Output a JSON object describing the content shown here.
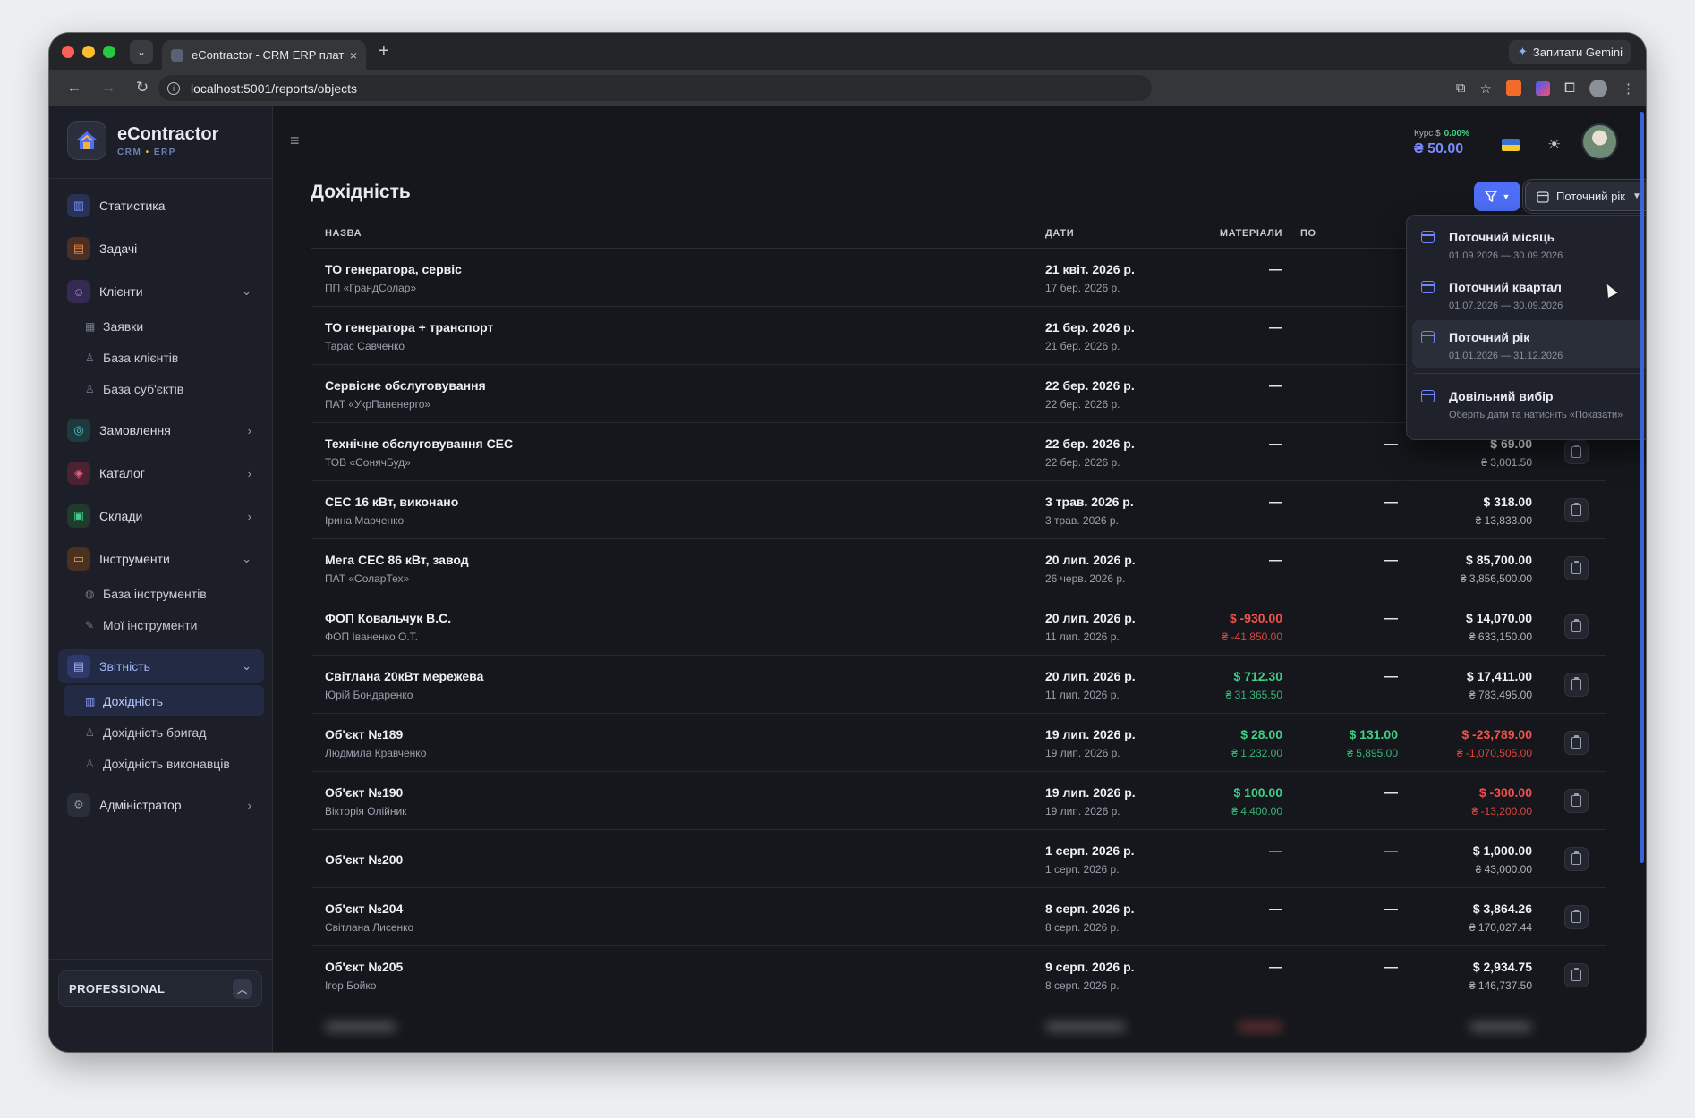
{
  "browser": {
    "tab_title": "eContractor - CRM ERP плат",
    "tab_close": "×",
    "new_tab": "+",
    "url": "localhost:5001/reports/objects",
    "gemini_label": "Запитати Gemini"
  },
  "brand": {
    "name": "eContractor",
    "sub_a": "CRM",
    "sub_sep": "•",
    "sub_b": "ERP"
  },
  "sidebar": {
    "statistics": "Статистика",
    "tasks": "Задачі",
    "clients": "Клієнти",
    "clients_sub": [
      "Заявки",
      "База клієнтів",
      "База суб'єктів"
    ],
    "orders": "Замовлення",
    "catalog": "Каталог",
    "warehouses": "Склади",
    "tools": "Інструменти",
    "tools_sub": [
      "База інструментів",
      "Мої інструменти"
    ],
    "reports": "Звітність",
    "reports_sub": [
      "Дохідність",
      "Дохідність бригад",
      "Дохідність виконавців"
    ],
    "admin": "Адміністратор",
    "plan": "PROFESSIONAL"
  },
  "header": {
    "rate_label": "Курс $",
    "rate_change": "0.00%",
    "rate_value": "₴ 50.00"
  },
  "page": {
    "title": "Дохідність",
    "period_button": "Поточний рік"
  },
  "table": {
    "columns": {
      "name": "НАЗВА",
      "dates": "ДАТИ",
      "materials": "МАТЕРІАЛИ",
      "cut": "ПО"
    },
    "rows": [
      {
        "name": "ТО генератора, сервіс",
        "client": "ПП «ГрандСолар»",
        "date": "21 квіт. 2026 р.",
        "date2": "17 бер. 2026 р.",
        "mat": "—",
        "mat2": "",
        "mat_type": "dash",
        "pos": "",
        "pos2": "",
        "pos_type": "none",
        "total": "",
        "total2": "",
        "total_type": "none"
      },
      {
        "name": "ТО генератора + транспорт",
        "client": "Тарас Савченко",
        "date": "21 бер. 2026 р.",
        "date2": "21 бер. 2026 р.",
        "mat": "—",
        "mat2": "",
        "mat_type": "dash",
        "pos": "",
        "pos2": "",
        "pos_type": "none",
        "total": "",
        "total2": "",
        "total_type": "none"
      },
      {
        "name": "Сервісне обслуговування",
        "client": "ПАТ «УкрПаненерго»",
        "date": "22 бер. 2026 р.",
        "date2": "22 бер. 2026 р.",
        "mat": "—",
        "mat2": "",
        "mat_type": "dash",
        "pos": "",
        "pos2": "",
        "pos_type": "none",
        "total": "",
        "total2": "",
        "total_type": "none"
      },
      {
        "name": "Технічне обслуговування СЕС",
        "client": "ТОВ «СонячБуд»",
        "date": "22 бер. 2026 р.",
        "date2": "22 бер. 2026 р.",
        "mat": "—",
        "mat2": "",
        "mat_type": "dash",
        "pos": "—",
        "pos2": "",
        "pos_type": "dash",
        "total": "$ 69.00",
        "total2": "₴ 3,001.50",
        "total_type": "wht"
      },
      {
        "name": "СЕС 16 кВт, виконано",
        "client": "Ірина Марченко",
        "date": "3 трав. 2026 р.",
        "date2": "3 трав. 2026 р.",
        "mat": "—",
        "mat2": "",
        "mat_type": "dash",
        "pos": "—",
        "pos2": "",
        "pos_type": "dash",
        "total": "$ 318.00",
        "total2": "₴ 13,833.00",
        "total_type": "wht"
      },
      {
        "name": "Мега СЕС 86 кВт, завод",
        "client": "ПАТ «СоларТех»",
        "date": "20 лип. 2026 р.",
        "date2": "26 черв. 2026 р.",
        "mat": "—",
        "mat2": "",
        "mat_type": "dash",
        "pos": "—",
        "pos2": "",
        "pos_type": "dash",
        "total": "$ 85,700.00",
        "total2": "₴ 3,856,500.00",
        "total_type": "wht"
      },
      {
        "name": "ФОП Ковальчук В.С.",
        "client": "ФОП Іваненко О.Т.",
        "date": "20 лип. 2026 р.",
        "date2": "11 лип. 2026 р.",
        "mat": "$ -930.00",
        "mat2": "₴ -41,850.00",
        "mat_type": "neg",
        "pos": "—",
        "pos2": "",
        "pos_type": "dash",
        "total": "$ 14,070.00",
        "total2": "₴ 633,150.00",
        "total_type": "wht"
      },
      {
        "name": "Світлана 20кВт мережева",
        "client": "Юрій Бондаренко",
        "date": "20 лип. 2026 р.",
        "date2": "11 лип. 2026 р.",
        "mat": "$ 712.30",
        "mat2": "₴ 31,365.50",
        "mat_type": "pos",
        "pos": "—",
        "pos2": "",
        "pos_type": "dash",
        "total": "$ 17,411.00",
        "total2": "₴ 783,495.00",
        "total_type": "wht"
      },
      {
        "name": "Об'єкт №189",
        "client": "Людмила Кравченко",
        "date": "19 лип. 2026 р.",
        "date2": "19 лип. 2026 р.",
        "mat": "$ 28.00",
        "mat2": "₴ 1,232.00",
        "mat_type": "pos",
        "pos": "$ 131.00",
        "pos2": "₴ 5,895.00",
        "pos_type": "pos",
        "total": "$ -23,789.00",
        "total2": "₴ -1,070,505.00",
        "total_type": "neg"
      },
      {
        "name": "Об'єкт №190",
        "client": "Вікторія Олійник",
        "date": "19 лип. 2026 р.",
        "date2": "19 лип. 2026 р.",
        "mat": "$ 100.00",
        "mat2": "₴ 4,400.00",
        "mat_type": "pos",
        "pos": "—",
        "pos2": "",
        "pos_type": "dash",
        "total": "$ -300.00",
        "total2": "₴ -13,200.00",
        "total_type": "neg"
      },
      {
        "name": "Об'єкт №200",
        "client": "",
        "date": "1 серп. 2026 р.",
        "date2": "1 серп. 2026 р.",
        "mat": "—",
        "mat2": "",
        "mat_type": "dash",
        "pos": "—",
        "pos2": "",
        "pos_type": "dash",
        "total": "$ 1,000.00",
        "total2": "₴ 43,000.00",
        "total_type": "wht"
      },
      {
        "name": "Об'єкт №204",
        "client": "Світлана Лисенко",
        "date": "8 серп. 2026 р.",
        "date2": "8 серп. 2026 р.",
        "mat": "—",
        "mat2": "",
        "mat_type": "dash",
        "pos": "—",
        "pos2": "",
        "pos_type": "dash",
        "total": "$ 3,864.26",
        "total2": "₴ 170,027.44",
        "total_type": "wht"
      },
      {
        "name": "Об'єкт №205",
        "client": "Ігор Бойко",
        "date": "9 серп. 2026 р.",
        "date2": "8 серп. 2026 р.",
        "mat": "—",
        "mat2": "",
        "mat_type": "dash",
        "pos": "—",
        "pos2": "",
        "pos_type": "dash",
        "total": "$ 2,934.75",
        "total2": "₴ 146,737.50",
        "total_type": "wht"
      }
    ]
  },
  "dropdown": {
    "options": [
      {
        "label": "Поточний місяць",
        "desc": "01.09.2026 — 30.09.2026",
        "selected": false
      },
      {
        "label": "Поточний квартал",
        "desc": "01.07.2026 — 30.09.2026",
        "selected": false
      },
      {
        "label": "Поточний рік",
        "desc": "01.01.2026 — 31.12.2026",
        "selected": true
      }
    ],
    "custom": {
      "label": "Довільний вибір",
      "desc": "Оберіть дати та натисніть «Показати»"
    }
  },
  "icons": {
    "statistics": "bar-chart-icon",
    "tasks": "clipboard-icon",
    "clients": "users-icon",
    "orders": "globe-icon",
    "catalog": "box-icon",
    "warehouses": "warehouse-icon",
    "tools": "toolbox-icon",
    "reports": "report-icon",
    "admin": "gear-icon"
  },
  "colors": {
    "accent": "#4f6ef7",
    "positive": "#3fcf86",
    "negative": "#f0524c"
  }
}
